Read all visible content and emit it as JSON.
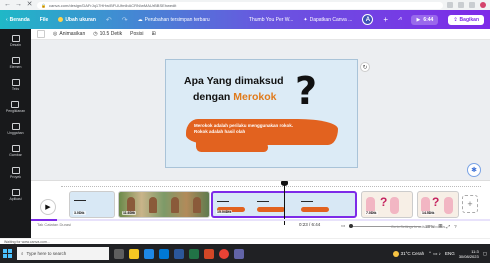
{
  "browser": {
    "url": "canva.com/design/DAFrJq17HHw/BFUUfmlbACRN/wMAUrBBSEhwedit",
    "lock_icon": "lock-icon"
  },
  "toolbar": {
    "home": "Beranda",
    "file": "File",
    "save_status": "Ubah ukuran",
    "sync": "Perubahan tersimpan terbaru",
    "design_name": "Thumb You Per W...",
    "collab": "Dapatkan Canva ...",
    "avatar": "A",
    "play_time": "6:44",
    "share": "Bagikan"
  },
  "sidebar": {
    "items": [
      {
        "label": "Desain",
        "icon": "layout-icon"
      },
      {
        "label": "Elemen",
        "icon": "shapes-icon"
      },
      {
        "label": "Teks",
        "icon": "text-icon"
      },
      {
        "label": "Pengiklanan",
        "icon": "brand-icon"
      },
      {
        "label": "Unggahan",
        "icon": "upload-icon"
      },
      {
        "label": "Gambar",
        "icon": "draw-icon"
      },
      {
        "label": "Proyek",
        "icon": "folder-icon"
      },
      {
        "label": "Aplikasi",
        "icon": "apps-icon"
      }
    ]
  },
  "subtoolbar": {
    "animate": "Animasikan",
    "duration": "10.5 Detik",
    "position": "Posisi"
  },
  "slide": {
    "title_line1": "Apa Yang dimaksud",
    "title_line2_a": "dengan ",
    "title_line2_b": "Merokok",
    "question_mark": "?",
    "body_line1": "Merokok adalah perilaku menggunakan rokok.",
    "body_line2": "Rokok adalah hasil olah"
  },
  "timeline": {
    "clips": [
      {
        "label": "3.0Dtk"
      },
      {
        "label": "11.6Dtk"
      },
      {
        "label": "15.04Dtk"
      },
      {
        "label": ""
      },
      {
        "label": "7.0Dtk"
      },
      {
        "label": "14.5Dtk"
      }
    ],
    "time": "0:23 / 6:44",
    "zoom": "20%",
    "progress_fraction": 0.057,
    "status_hint": "Waiting for www.canva.com...",
    "windows_watermark": "Go to Settings to activate Windows.",
    "left_hint": "Tak Catatan  Durasi"
  },
  "taskbar": {
    "search_placeholder": "Type here to search",
    "weather": "31°C  Cerah",
    "time": "11:3",
    "date": "30/08/2023",
    "lang": "ENG"
  },
  "colors": {
    "accent": "#7d2ae8",
    "toolbar_start": "#1fb8c7",
    "slide_bg": "#dcebf6",
    "orange": "#e2621f"
  }
}
